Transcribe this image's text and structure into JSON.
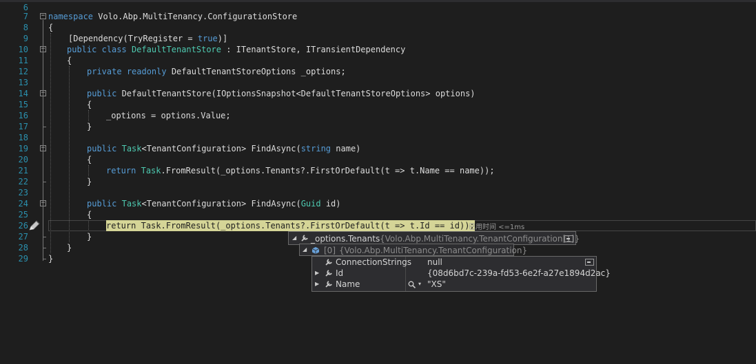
{
  "editor": {
    "line_numbers": [
      "6",
      "7",
      "8",
      "9",
      "10",
      "11",
      "12",
      "13",
      "14",
      "15",
      "16",
      "17",
      "18",
      "19",
      "20",
      "21",
      "22",
      "23",
      "24",
      "25",
      "26",
      "27",
      "28",
      "29"
    ],
    "lines": {
      "l7": {
        "kw": "namespace",
        "rest": " Volo.Abp.MultiTenancy.ConfigurationStore"
      },
      "l8": "{",
      "l9": {
        "a": "[Dependency(TryRegister = ",
        "kw": "true",
        "b": ")]"
      },
      "l10": {
        "kw1": "public",
        "kw2": "class",
        "ty": "DefaultTenantStore",
        "rest": " : ITenantStore, ITransientDependency"
      },
      "l11": "{",
      "l12": {
        "kw1": "private",
        "kw2": "readonly",
        "rest": " DefaultTenantStoreOptions _options;"
      },
      "l14": {
        "kw": "public",
        "rest": " DefaultTenantStore(IOptionsSnapshot<DefaultTenantStoreOptions> options)"
      },
      "l15": "{",
      "l16": "_options = options.Value;",
      "l17": "}",
      "l19": {
        "kw": "public",
        "ty": "Task",
        "a": "<TenantConfiguration> FindAsync(",
        "kw2": "string",
        "b": " name)"
      },
      "l20": "{",
      "l21": {
        "kw": "return",
        "ty": "Task",
        "rest": ".FromResult(_options.Tenants?.FirstOrDefault(t => t.Name == name));"
      },
      "l22": "}",
      "l24": {
        "kw": "public",
        "ty": "Task",
        "a": "<TenantConfiguration> FindAsync(",
        "ty2": "Guid",
        "b": " id)"
      },
      "l25": "{",
      "l26": {
        "kw": "return",
        "ty": "Task",
        "rest": ".FromResult(_options.Tenants?.FirstOrDefault(t => t.Id == id));"
      },
      "l27": "}",
      "l28": "}",
      "l29": "}"
    },
    "elapsed_label": "已用时间 <=1ms"
  },
  "datatip": {
    "root": {
      "name": "_options.Tenants",
      "value": "{Volo.Abp.MultiTenancy.TenantConfiguration[1]}"
    },
    "item": {
      "name": "[0]",
      "value": "{Volo.Abp.MultiTenancy.TenantConfiguration}"
    },
    "props": [
      {
        "name": "ConnectionStrings",
        "value": "null"
      },
      {
        "name": "Id",
        "value": "{08d6bd7c-239a-fd53-6e2f-a27e1894d2ac}"
      },
      {
        "name": "Name",
        "value": "\"XS\""
      }
    ]
  },
  "colors": {
    "keyword": "#569cd6",
    "type": "#4ec9b0",
    "line_number": "#2b91af",
    "highlight": "#d5d597"
  }
}
